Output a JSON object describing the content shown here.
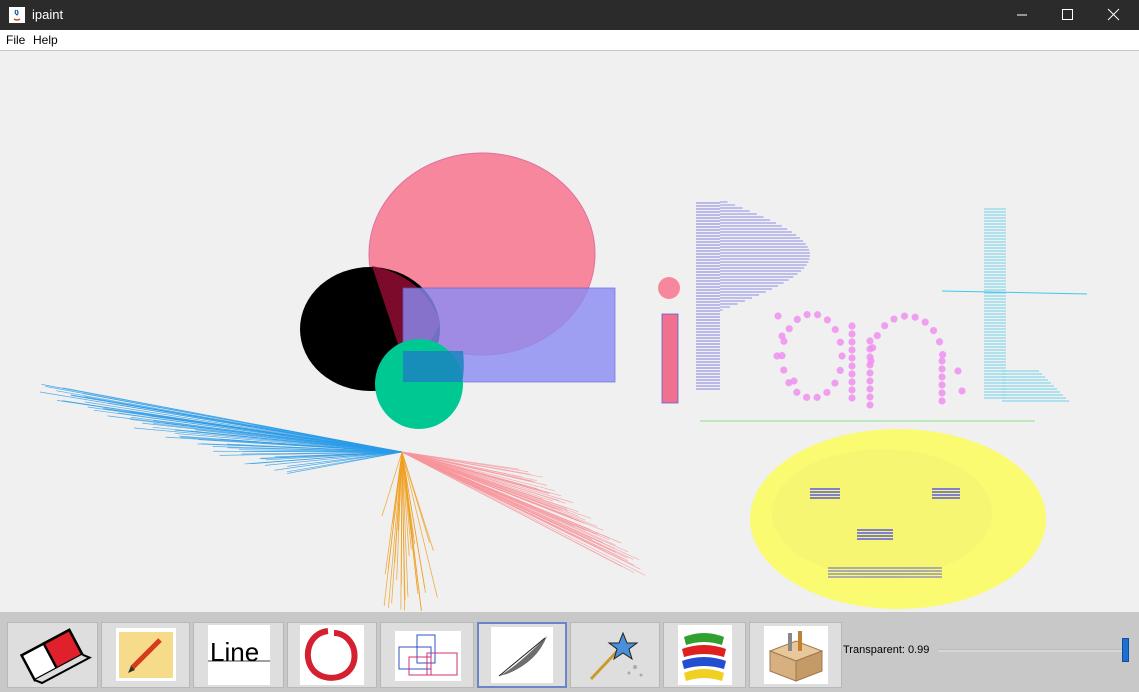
{
  "window": {
    "title": "ipaint"
  },
  "menu": {
    "file": "File",
    "help": "Help"
  },
  "canvas": {
    "logo_text": "iPaint"
  },
  "tools": [
    {
      "name": "eraser",
      "icon": "eraser-icon"
    },
    {
      "name": "pencil",
      "icon": "pencil-icon"
    },
    {
      "name": "line",
      "icon": "line-icon",
      "label": "Line"
    },
    {
      "name": "circle",
      "icon": "enso-circle-icon"
    },
    {
      "name": "rectangle",
      "icon": "rectangles-icon"
    },
    {
      "name": "feather",
      "icon": "feather-icon",
      "active": true
    },
    {
      "name": "magic-wand",
      "icon": "magic-wand-icon"
    },
    {
      "name": "paint-color",
      "icon": "paint-strokes-icon"
    },
    {
      "name": "tools-box",
      "icon": "toolbox-icon"
    }
  ],
  "transparency": {
    "label": "Transparent: 0.99",
    "value": 0.99
  },
  "colors": {
    "accent": "#1e6fd0",
    "pink": "#f7879c",
    "blue": "#9b9ff7",
    "teal": "#00c893",
    "yellow": "#fbfb6a"
  }
}
